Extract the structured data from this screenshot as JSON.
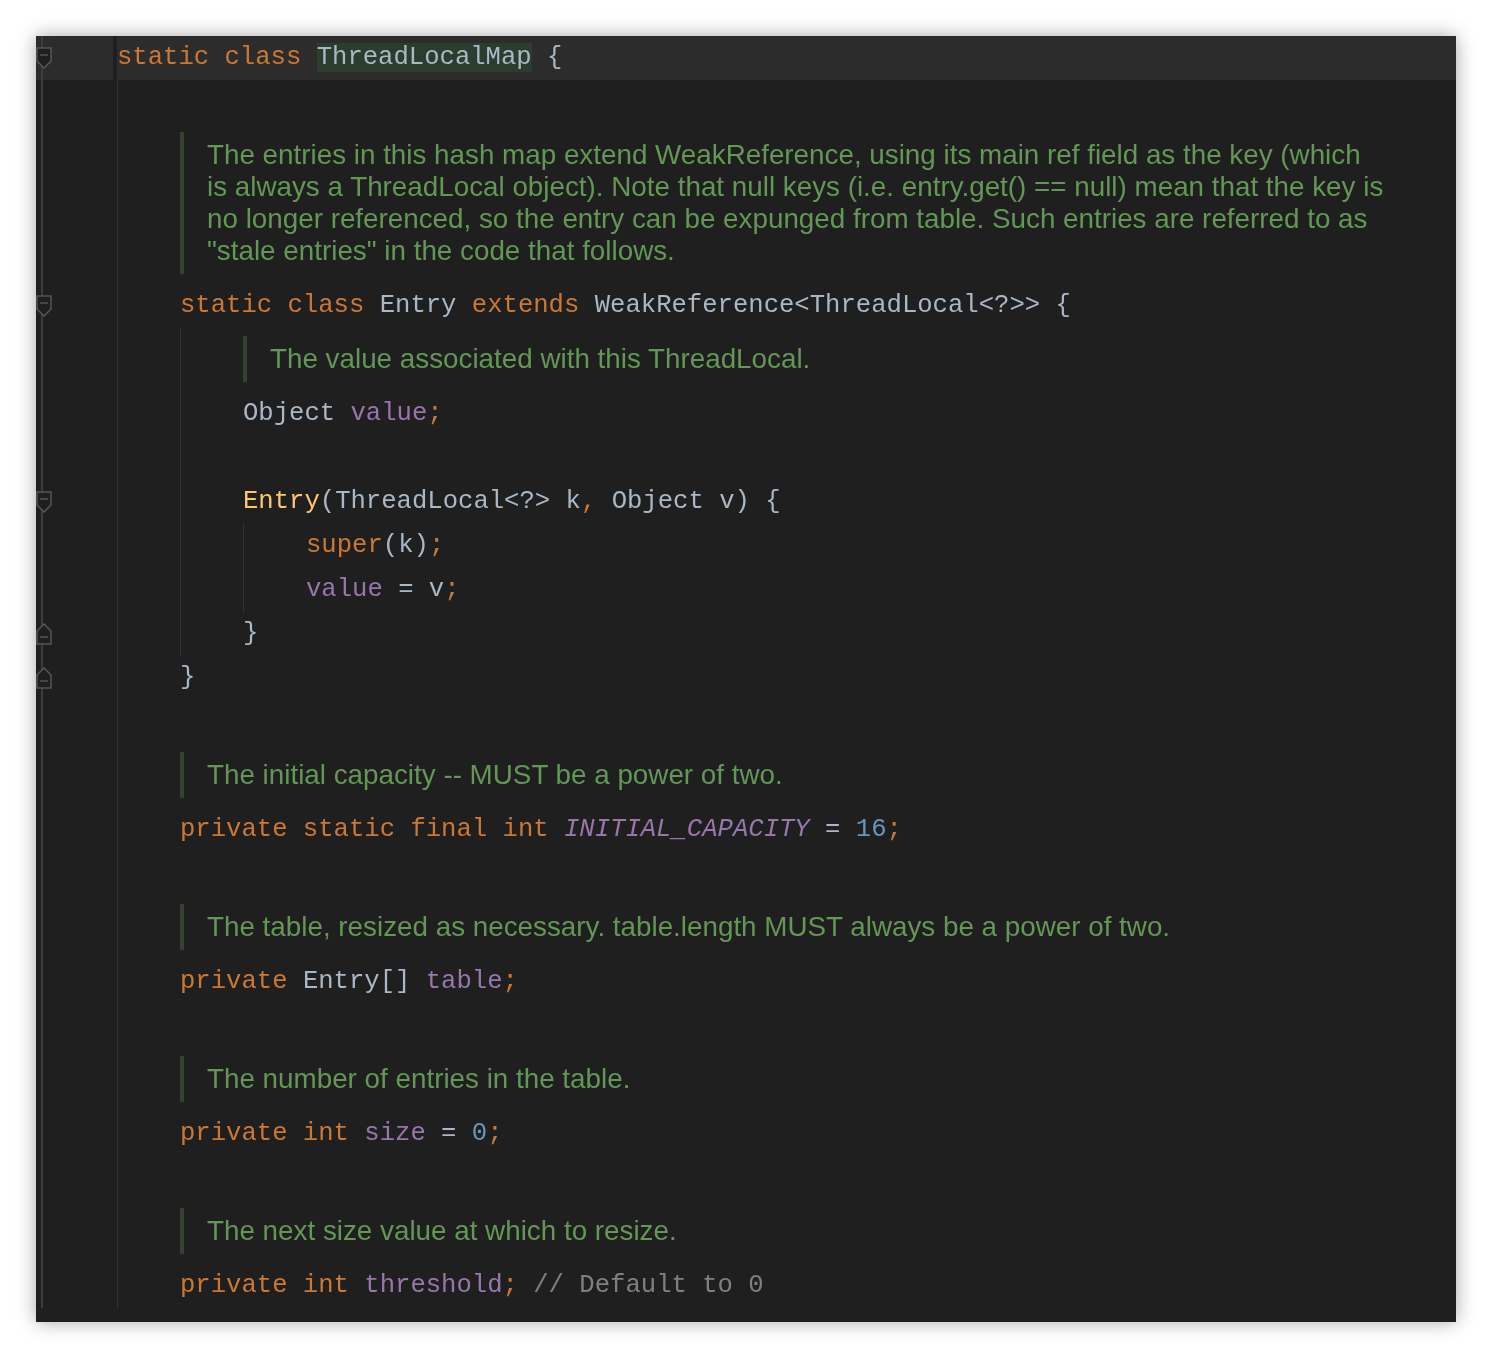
{
  "lines": [
    {
      "kind": "code",
      "current": true,
      "fold_start": true,
      "tokens": [
        {
          "text": "static class ",
          "kind": "keyword"
        },
        {
          "text": "ThreadLocalMap",
          "kind": "type",
          "highlighted": true
        },
        {
          "text": " {",
          "kind": "plain"
        }
      ],
      "children": [
        {
          "kind": "blank"
        },
        {
          "kind": "doc",
          "text": "The entries in this hash map extend WeakReference, using its main ref field as the key (which is always a ThreadLocal object). Note that null keys (i.e. entry.get() == null) mean that the key is no longer referenced, so the entry can be expunged from table. Such entries are referred to as \"stale entries\" in the code that follows."
        },
        {
          "kind": "code",
          "current": false,
          "fold_start": true,
          "tokens": [
            {
              "text": "static class ",
              "kind": "keyword"
            },
            {
              "text": "Entry ",
              "kind": "type"
            },
            {
              "text": "extends ",
              "kind": "keyword"
            },
            {
              "text": "WeakReference<ThreadLocal<?>> {",
              "kind": "type"
            }
          ],
          "children": [
            {
              "kind": "doc",
              "text": "The value associated with this ThreadLocal."
            },
            {
              "kind": "code",
              "current": false,
              "tokens": [
                {
                  "text": "Object ",
                  "kind": "type"
                },
                {
                  "text": "value",
                  "kind": "field"
                },
                {
                  "text": ";",
                  "kind": "keyword"
                }
              ]
            },
            {
              "kind": "blank"
            },
            {
              "kind": "code",
              "current": false,
              "fold_start": true,
              "tokens": [
                {
                  "text": "Entry",
                  "kind": "method"
                },
                {
                  "text": "(ThreadLocal<?> k",
                  "kind": "plain"
                },
                {
                  "text": ", ",
                  "kind": "keyword"
                },
                {
                  "text": "Object v) {",
                  "kind": "plain"
                }
              ],
              "children": [
                {
                  "kind": "code",
                  "current": false,
                  "tokens": [
                    {
                      "text": "super",
                      "kind": "keyword"
                    },
                    {
                      "text": "(k)",
                      "kind": "plain"
                    },
                    {
                      "text": ";",
                      "kind": "keyword"
                    }
                  ]
                },
                {
                  "kind": "code",
                  "current": false,
                  "tokens": [
                    {
                      "text": "value",
                      "kind": "field"
                    },
                    {
                      "text": " = v",
                      "kind": "plain"
                    },
                    {
                      "text": ";",
                      "kind": "keyword"
                    }
                  ]
                }
              ]
            },
            {
              "kind": "code",
              "current": false,
              "fold_end": true,
              "tokens": [
                {
                  "text": "}",
                  "kind": "plain"
                }
              ]
            }
          ]
        },
        {
          "kind": "code",
          "current": false,
          "fold_end": true,
          "tokens": [
            {
              "text": "}",
              "kind": "plain"
            }
          ]
        },
        {
          "kind": "blank"
        },
        {
          "kind": "doc",
          "text": "The initial capacity -- MUST be a power of two."
        },
        {
          "kind": "code",
          "current": false,
          "tokens": [
            {
              "text": "private static final int ",
              "kind": "keyword"
            },
            {
              "text": "INITIAL_CAPACITY",
              "kind": "constant"
            },
            {
              "text": " = ",
              "kind": "plain"
            },
            {
              "text": "16",
              "kind": "number"
            },
            {
              "text": ";",
              "kind": "keyword"
            }
          ]
        },
        {
          "kind": "blank"
        },
        {
          "kind": "doc",
          "text": "The table, resized as necessary. table.length MUST always be a power of two."
        },
        {
          "kind": "code",
          "current": false,
          "tokens": [
            {
              "text": "private ",
              "kind": "keyword"
            },
            {
              "text": "Entry[] ",
              "kind": "type"
            },
            {
              "text": "table",
              "kind": "field"
            },
            {
              "text": ";",
              "kind": "keyword"
            }
          ]
        },
        {
          "kind": "blank"
        },
        {
          "kind": "doc",
          "text": "The number of entries in the table."
        },
        {
          "kind": "code",
          "current": false,
          "tokens": [
            {
              "text": "private int ",
              "kind": "keyword"
            },
            {
              "text": "size",
              "kind": "field"
            },
            {
              "text": " = ",
              "kind": "plain"
            },
            {
              "text": "0",
              "kind": "number"
            },
            {
              "text": ";",
              "kind": "keyword"
            }
          ]
        },
        {
          "kind": "blank"
        },
        {
          "kind": "doc",
          "text": "The next size value at which to resize."
        },
        {
          "kind": "code",
          "current": false,
          "tokens": [
            {
              "text": "private int ",
              "kind": "keyword"
            },
            {
              "text": "threshold",
              "kind": "field"
            },
            {
              "text": "; ",
              "kind": "keyword"
            },
            {
              "text": "// Default to 0",
              "kind": "comment"
            }
          ]
        }
      ]
    }
  ]
}
